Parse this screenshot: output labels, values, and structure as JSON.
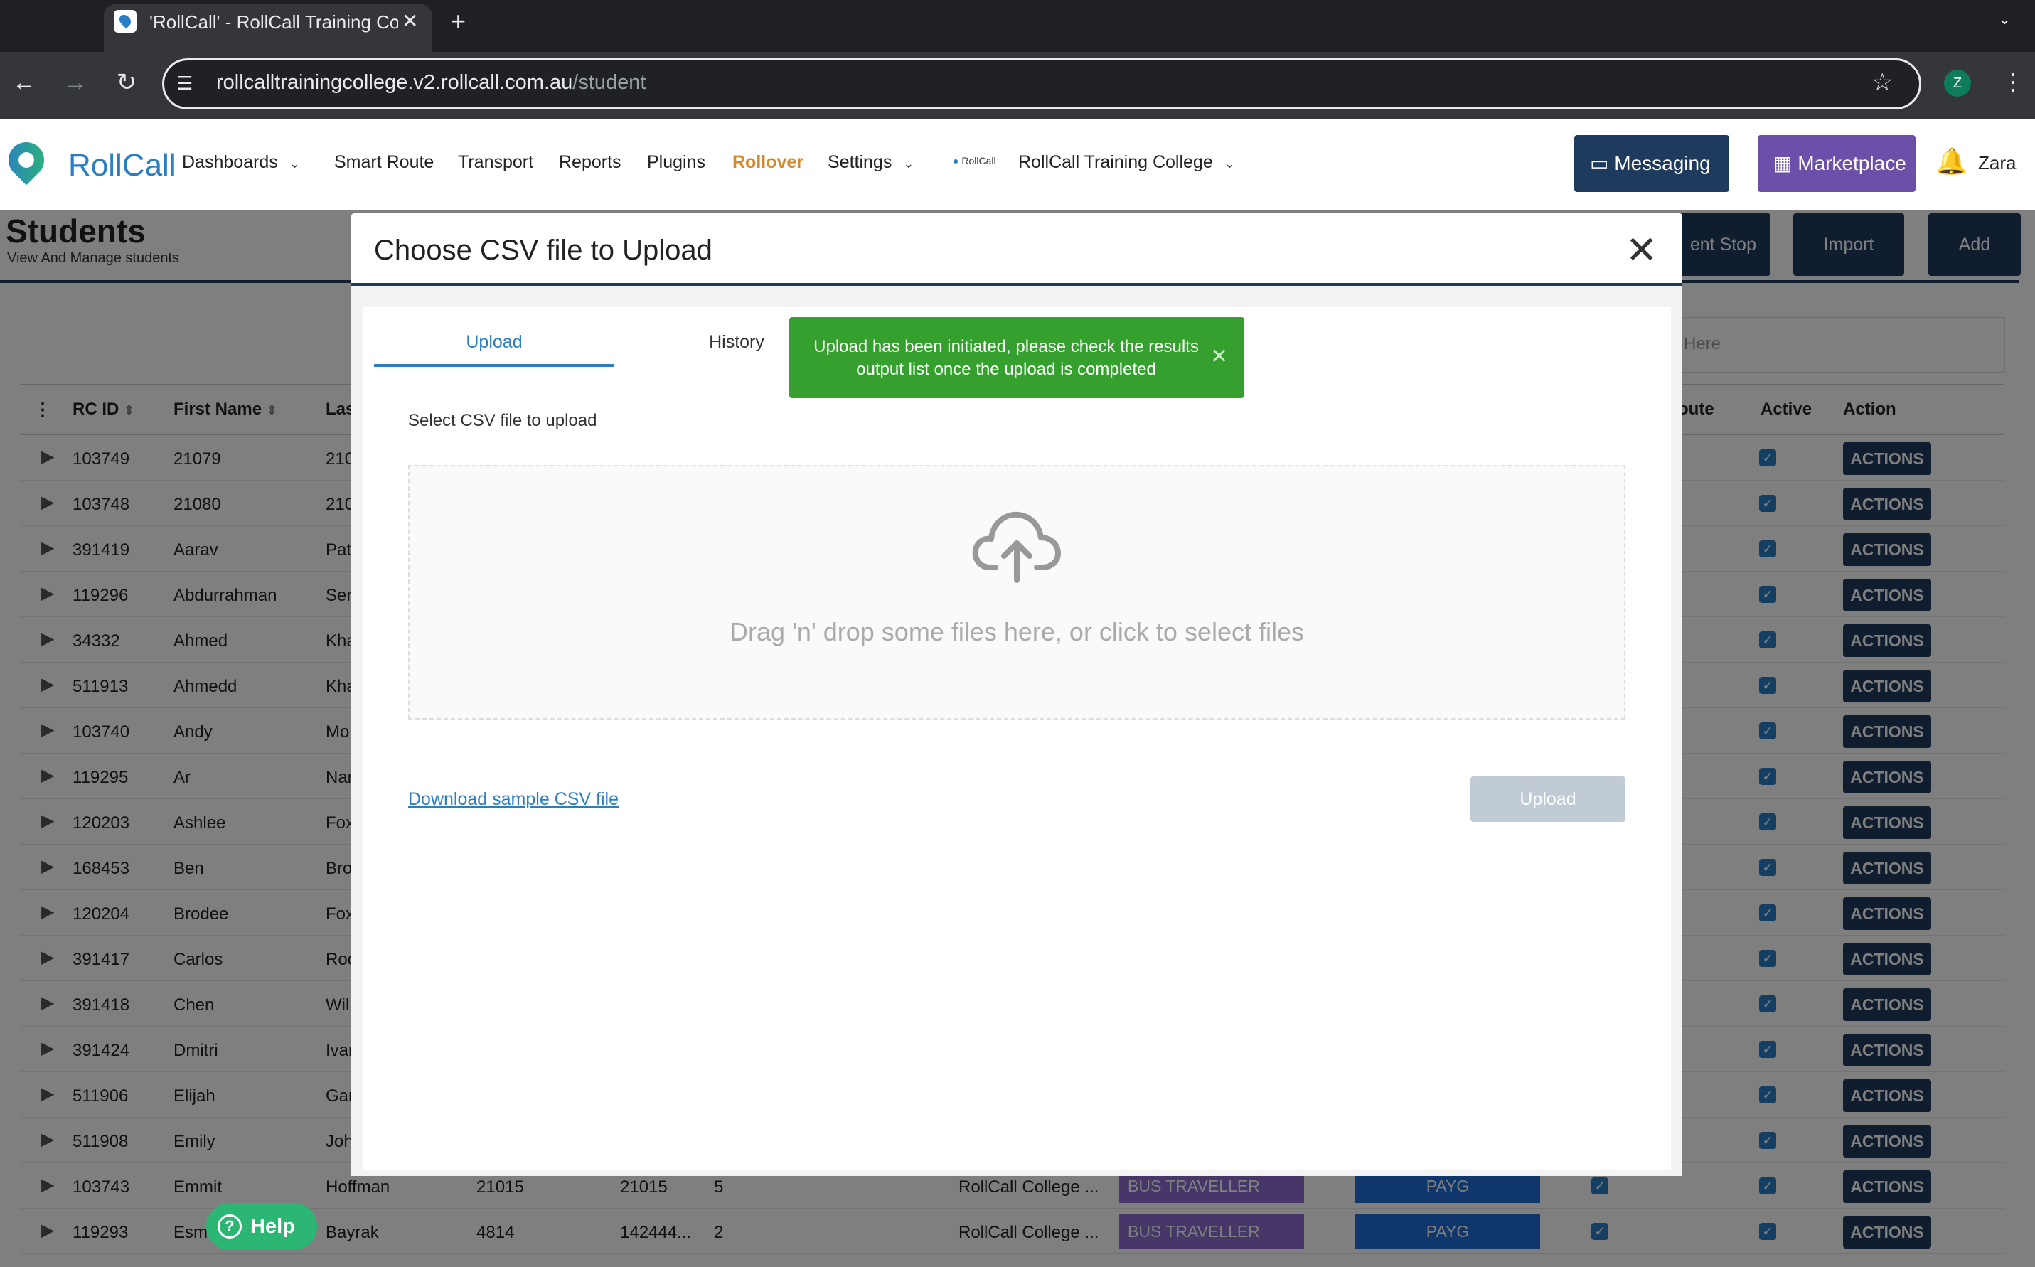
{
  "browser": {
    "tab_title": "'RollCall' - RollCall Training College",
    "tab_close": "✕",
    "new_tab": "+",
    "url_host": "rollcalltrainingcollege.v2.rollcall.com.au",
    "url_path": "/student",
    "profile_initial": "Z"
  },
  "app": {
    "logo_text": "RollCall",
    "nav": {
      "dashboards": "Dashboards",
      "smart_route": "Smart Route",
      "transport": "Transport",
      "reports": "Reports",
      "plugins": "Plugins",
      "rollover": "Rollover",
      "settings": "Settings",
      "college_logo_text": "RollCall",
      "college": "RollCall Training College"
    },
    "messaging": "Messaging",
    "marketplace": "Marketplace",
    "user": "Zara",
    "accent": "#2a7fc4",
    "navy": "#1e3a5c"
  },
  "page": {
    "title": "Students",
    "subtitle": "View And Manage students",
    "buttons": {
      "stop": "ent Stop",
      "import": "Import",
      "add": "Add"
    },
    "search_placeholder": "Here",
    "columns": {
      "rcid": "RC ID",
      "first": "First Name",
      "last": "Las",
      "route": "oute",
      "active": "Active",
      "action": "Action"
    },
    "action_label": "ACTIONS",
    "rows": [
      {
        "id": "103749",
        "first": "21079",
        "last": "210"
      },
      {
        "id": "103748",
        "first": "21080",
        "last": "210"
      },
      {
        "id": "391419",
        "first": "Aarav",
        "last": "Pat"
      },
      {
        "id": "119296",
        "first": "Abdurrahman",
        "last": "Ser"
      },
      {
        "id": "34332",
        "first": "Ahmed",
        "last": "Kha"
      },
      {
        "id": "511913",
        "first": "Ahmedd",
        "last": "Kha"
      },
      {
        "id": "103740",
        "first": "Andy",
        "last": "Mor"
      },
      {
        "id": "119295",
        "first": "Ar",
        "last": "Nar"
      },
      {
        "id": "120203",
        "first": "Ashlee",
        "last": "Fox"
      },
      {
        "id": "168453",
        "first": "Ben",
        "last": "Bro"
      },
      {
        "id": "120204",
        "first": "Brodee",
        "last": "Fox"
      },
      {
        "id": "391417",
        "first": "Carlos",
        "last": "Roc"
      },
      {
        "id": "391418",
        "first": "Chen",
        "last": "Will"
      },
      {
        "id": "391424",
        "first": "Dmitri",
        "last": "Ivar"
      },
      {
        "id": "511906",
        "first": "Elijah",
        "last": "Gar"
      },
      {
        "id": "511908",
        "first": "Emily",
        "last": "Joh"
      }
    ],
    "full_rows": [
      {
        "id": "103743",
        "first": "Emmit",
        "last": "Hoffman",
        "c1": "21015",
        "c2": "21015",
        "c3": "5",
        "campus": "RollCall College ...",
        "type": "BUS TRAVELLER",
        "pay": "PAYG"
      },
      {
        "id": "119293",
        "first": "Esm",
        "last": "Bayrak",
        "c1": "4814",
        "c2": "142444...",
        "c3": "2",
        "campus": "RollCall College ...",
        "type": "BUS TRAVELLER",
        "pay": "PAYG"
      }
    ]
  },
  "modal": {
    "title": "Choose CSV file to Upload",
    "close": "✕",
    "tabs": {
      "upload": "Upload",
      "history": "History"
    },
    "toast": "Upload has been initiated, please check the results output list once the upload is completed",
    "select_label": "Select CSV file to upload",
    "drop_text": "Drag 'n' drop some files here, or click to select files",
    "sample_link": "Download sample CSV file",
    "upload_button": "Upload",
    "toast_color": "#35a02e"
  },
  "help": {
    "label": "Help"
  }
}
